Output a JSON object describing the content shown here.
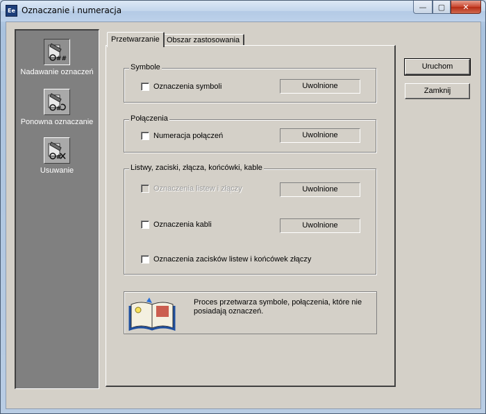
{
  "window": {
    "title": "Oznaczanie i numeracja",
    "app_icon_text": "Ee",
    "controls": {
      "minimize": "—",
      "maximize": "▢",
      "close": "✕"
    }
  },
  "sidebar": {
    "items": [
      {
        "label": "Nadawanie oznaczeń",
        "icon": "assign-designation-icon",
        "active": true
      },
      {
        "label": "Ponowna oznaczanie",
        "icon": "redesignate-icon",
        "active": false
      },
      {
        "label": "Usuwanie",
        "icon": "delete-designation-icon",
        "active": false
      }
    ]
  },
  "tabs": [
    {
      "label": "Przetwarzanie",
      "active": true
    },
    {
      "label": "Obszar zastosowania",
      "active": false
    }
  ],
  "groups": {
    "symbols": {
      "title": "Symbole",
      "option_label": "Oznaczenia symboli",
      "checked": false,
      "status": "Uwolnione"
    },
    "connections": {
      "title": "Połączenia",
      "option_label": "Numeracja połączeń",
      "checked": false,
      "status": "Uwolnione"
    },
    "strips": {
      "title": "Listwy, zaciski, złącza, końcówki, kable",
      "strip_option_label": "Oznaczenia listew i złączy",
      "strip_status": "Uwolnione",
      "cable_option_label": "Oznaczenia kabli",
      "cable_status": "Uwolnione",
      "terminal_option_label": "Oznaczenia zacisków listew i końcówek złączy"
    }
  },
  "info": {
    "text": "Proces przetwarza symbole, połączenia, które nie posiadają oznaczeń.",
    "icon": "tip-book-icon"
  },
  "buttons": {
    "run": "Uruchom",
    "close": "Zamknij"
  }
}
